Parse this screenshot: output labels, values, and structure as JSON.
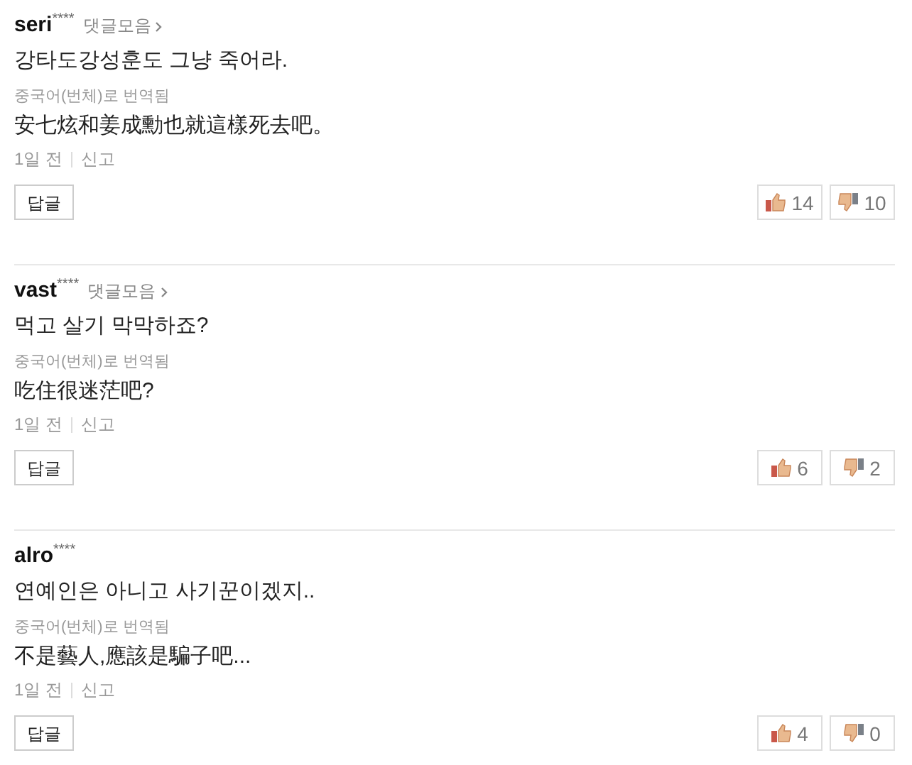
{
  "comments": [
    {
      "author": "**seri**$^{****}$",
      "collection_link": "댓글모음",
      "text": "강타도강성훈도 그냥 죽어라.",
      "translation_note": "중국어(번체)로 번역됨",
      "translation": "安七炫和姜成勳也就這樣死去吧。",
      "time": "1일 전",
      "report": "신고",
      "reply": "답글",
      "likes": "14",
      "dislikes": "10"
    },
    {
      "author": "**vast**$^{****}$",
      "collection_link": "댓글모음",
      "text": "먹고 살기 막막하죠?",
      "translation_note": "중국어(번체)로 번역됨",
      "translation": "吃住很迷茫吧?",
      "time": "1일 전",
      "report": "신고",
      "reply": "답글",
      "likes": "6",
      "dislikes": "2"
    },
    {
      "author": "**alro**$^{****}$",
      "text": "연예인은 아니고 사기꾼이겠지..",
      "translation_note": "중국어(번체)로 번역됨",
      "translation": "不是藝人,應該是騙子吧...",
      "time": "1일 전",
      "report": "신고",
      "reply": "답글",
      "likes": "4",
      "dislikes": "0"
    }
  ]
}
